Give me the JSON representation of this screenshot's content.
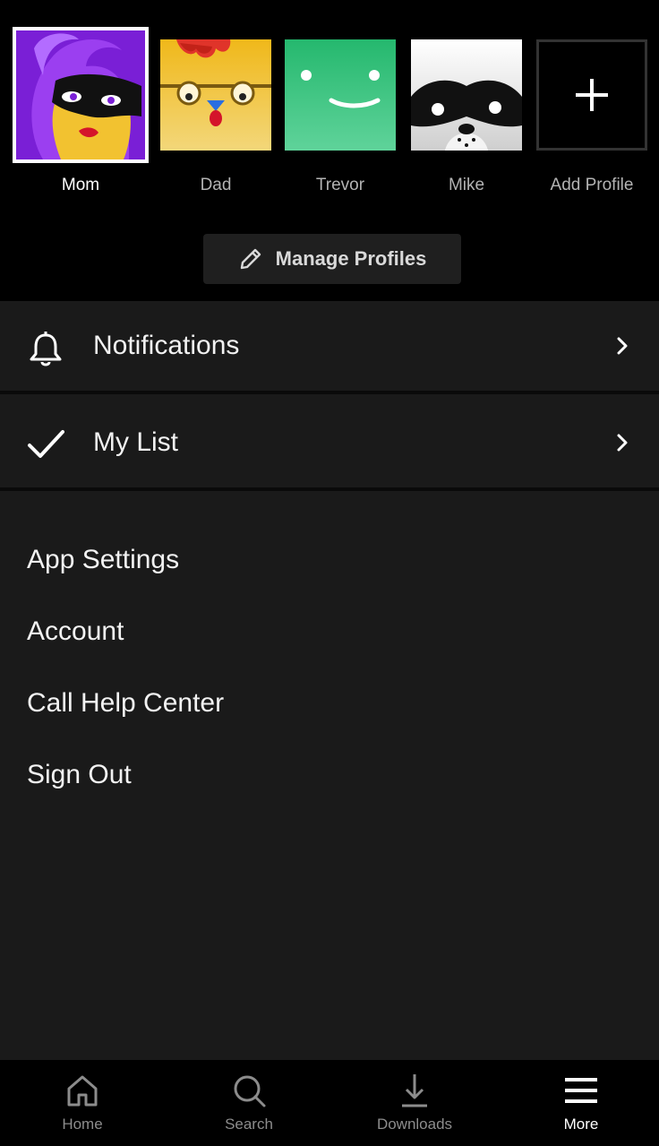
{
  "profiles": [
    {
      "name": "Mom",
      "selected": true,
      "icon": "masked-woman-avatar"
    },
    {
      "name": "Dad",
      "selected": false,
      "icon": "chicken-avatar"
    },
    {
      "name": "Trevor",
      "selected": false,
      "icon": "smiley-avatar"
    },
    {
      "name": "Mike",
      "selected": false,
      "icon": "masked-dog-avatar"
    }
  ],
  "add_profile_label": "Add Profile",
  "manage_profiles_label": "Manage Profiles",
  "rows": {
    "notifications": "Notifications",
    "my_list": "My List"
  },
  "links": {
    "app_settings": "App Settings",
    "account": "Account",
    "help_center": "Call Help Center",
    "sign_out": "Sign Out"
  },
  "nav": {
    "home": "Home",
    "search": "Search",
    "downloads": "Downloads",
    "more": "More",
    "active": "More"
  },
  "colors": {
    "mom_bg": "#7a1fd6",
    "dad_bg": "#f0c020",
    "trevor_bg": "#2fc07a",
    "mike_bg": "#e8e8e8"
  }
}
